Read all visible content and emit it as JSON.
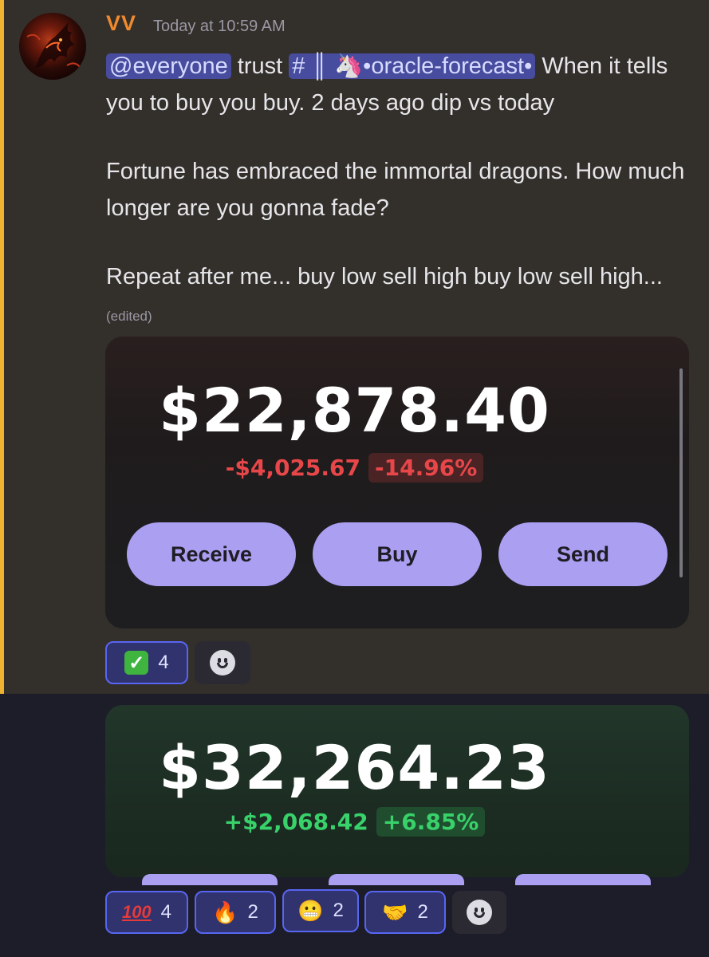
{
  "message": {
    "username": "VV",
    "timestamp": "Today at 10:59 AM",
    "mention": "@everyone",
    "text_after_mention": " trust ",
    "channel_pill": "# ║ 🦄•oracle-forecast•",
    "line1_rest": "  When it tells you to buy you buy. 2 days ago dip vs today",
    "paragraph2": "Fortune has embraced the immortal dragons. How much longer are you gonna fade?",
    "paragraph3": "Repeat after me... buy low sell high buy low sell high...",
    "edited_label": "(edited)"
  },
  "wallet_card_1": {
    "balance": "$22,878.40",
    "change": "-$4,025.67",
    "change_pct": "-14.96%",
    "buttons": {
      "receive": "Receive",
      "buy": "Buy",
      "send": "Send"
    },
    "colors": {
      "change": "#e8474a",
      "button": "#ab9ff2"
    }
  },
  "reactions_1": [
    {
      "emoji": "check-mark-button",
      "count": "4"
    }
  ],
  "wallet_card_2": {
    "balance": "$32,264.23",
    "change": "+$2,068.42",
    "change_pct": "+6.85%",
    "colors": {
      "change": "#38d16a"
    }
  },
  "reactions_2": [
    {
      "emoji": "hundred-points",
      "glyph": "100",
      "count": "4"
    },
    {
      "emoji": "fire",
      "glyph": "🔥",
      "count": "2"
    },
    {
      "emoji": "grimace-face",
      "glyph": "😬",
      "count": "2"
    },
    {
      "emoji": "handshake",
      "glyph": "🤝",
      "count": "2"
    }
  ]
}
